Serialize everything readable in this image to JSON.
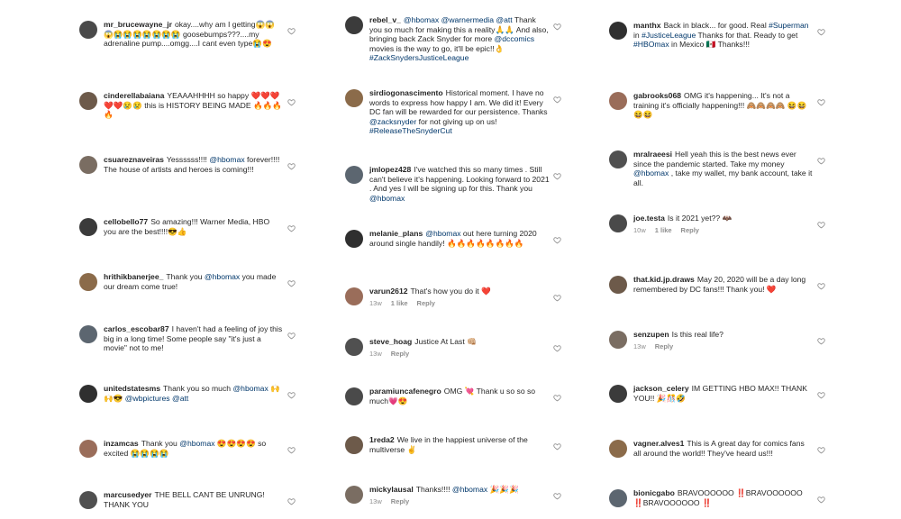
{
  "columns": [
    {
      "comments": [
        {
          "user": "mr_brucewayne_jr",
          "text": "okay....why am I getting😱😱😱😭😭😭😭😭😭😭 goosebumps???....my adrenaline pump....omgg....I cant even type😭😍",
          "meta": []
        },
        {
          "user": "cinderellabaiana",
          "text": "YEAAAHHHH so happy ❤️❤️❤️❤️❤️😢😢 this is HISTORY BEING MADE 🔥🔥🔥🔥",
          "meta": []
        },
        {
          "user": "csuareznaveiras",
          "text": "Yessssss!!!! @hbomax forever!!!! The house of artists and heroes is coming!!!",
          "meta": []
        },
        {
          "user": "cellobello77",
          "text": "So amazing!!! Warner Media, HBO you are the best!!!!😎👍",
          "meta": []
        },
        {
          "user": "hrithikbanerjee_",
          "text": "Thank you @hbomax you made our dream come true!",
          "meta": []
        },
        {
          "user": "carlos_escobar87",
          "text": "I haven't had a feeling of joy this big in a long time! Some people say \"it's just a movie\" not to me!",
          "meta": []
        },
        {
          "user": "unitedstatesms",
          "text": "Thank you so much @hbomax 🙌🙌😎 @wbpictures @att",
          "meta": []
        },
        {
          "user": "inzamcas",
          "text": "Thank you @hbomax 😍😍😍😍 so excited 😭😭😭😭",
          "meta": []
        },
        {
          "user": "marcusedyer",
          "text": "THE BELL CANT BE UNRUNG! THANK YOU",
          "meta": []
        }
      ]
    },
    {
      "comments": [
        {
          "user": "rebel_v_",
          "text": "@hbomax @warnermedia @att Thank you so much for making this a reality🙏🙏 And also, bringing back Zack Snyder for more @dccomics movies is the way to go, it'll be epic!!👌 #ZackSnydersJusticeLeague",
          "meta": []
        },
        {
          "user": "sirdiogonascimento",
          "text": "Historical moment. I have no words to express how happy I am. We did it! Every DC fan will be rewarded for our persistence. Thanks @zacksnyder for not giving up on us! #ReleaseTheSnyderCut",
          "meta": []
        },
        {
          "user": "jmlopez428",
          "text": "I've watched this so many times . Still can't believe it's happening. Looking forward to 2021 . And yes I will be signing up for this.  Thank you @hbomax",
          "meta": []
        },
        {
          "user": "melanie_plans",
          "text": "@hbomax out here turning 2020 around single handily! 🔥🔥🔥🔥🔥🔥🔥🔥",
          "meta": []
        },
        {
          "user": "varun2612",
          "text": "That's how you do it ❤️",
          "meta": [
            "13w",
            "1 like",
            "Reply"
          ]
        },
        {
          "user": "steve_hoag",
          "text": "Justice At Last 👊🏼",
          "meta": [
            "13w",
            "Reply"
          ]
        },
        {
          "user": "paramiuncafenegro",
          "text": "OMG 💘 Thank u so so so much💗😍",
          "meta": []
        },
        {
          "user": "1reda2",
          "text": "We live in the happiest universe of the multiverse ✌️",
          "meta": []
        },
        {
          "user": "mickylausal",
          "text": "Thanks!!!! @hbomax 🎉🎉🎉",
          "meta": [
            "13w",
            "Reply"
          ]
        }
      ]
    },
    {
      "comments": [
        {
          "user": "manthx",
          "text": "Back in black... for good. Real #Superman in #JusticeLeague Thanks for that. Ready to get #HBOmax in Mexico 🇲🇽 Thanks!!!",
          "meta": []
        },
        {
          "user": "gabrooks068",
          "text": "OMG it's happening... It's not a training it's officially happening!!! 🙈🙈🙈🙈 😆😆😆😆",
          "meta": []
        },
        {
          "user": "mralraeesi",
          "text": "Hell yeah this is the best news ever since the pandemic started. Take my money @hbomax , take my wallet, my bank account, take it all.",
          "meta": []
        },
        {
          "user": "joe.testa",
          "text": "Is it 2021 yet?? 🦇",
          "meta": [
            "10w",
            "1 like",
            "Reply"
          ]
        },
        {
          "user": "that.kid.jp.draws",
          "text": "May 20, 2020 will be a day long remembered by DC fans!!! Thank you! ❤️",
          "meta": []
        },
        {
          "user": "senzupen",
          "text": "Is this real life?",
          "meta": [
            "13w",
            "Reply"
          ]
        },
        {
          "user": "jackson_celery",
          "text": "IM GETTING HBO MAX!! THANK YOU!! 🎉🎊🤣",
          "meta": []
        },
        {
          "user": "vagner.alves1",
          "text": "This is A great day for comics fans all around the world!! They've heard us!!!",
          "meta": []
        },
        {
          "user": "bionicgabo",
          "text": "BRAVOOOOOO ‼️BRAVOOOOOO ‼️BRAVOOOOOO ‼️",
          "meta": []
        }
      ]
    }
  ],
  "colors": {
    "text": "#262626",
    "link": "#00376b",
    "meta": "#8e8e8e"
  },
  "icons": {
    "like": "heart-outline-icon"
  }
}
